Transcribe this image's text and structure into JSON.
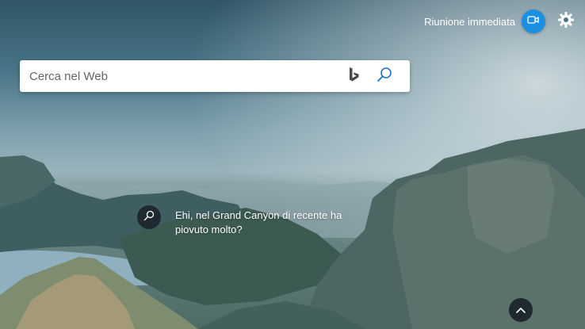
{
  "header": {
    "meet_label": "Riunione immediata",
    "meet_icon": "video-camera-icon",
    "settings_icon": "gear-icon",
    "accent": "#1d8fe1"
  },
  "search": {
    "placeholder": "Cerca nel Web",
    "value": "",
    "brand_icon": "bing-logo-icon",
    "submit_icon": "search-icon"
  },
  "background_question": {
    "icon": "search-icon",
    "text": "Ehi, nel Grand Canyon di recente ha piovuto molto?"
  },
  "footer": {
    "scroll_icon": "chevron-up-icon"
  }
}
